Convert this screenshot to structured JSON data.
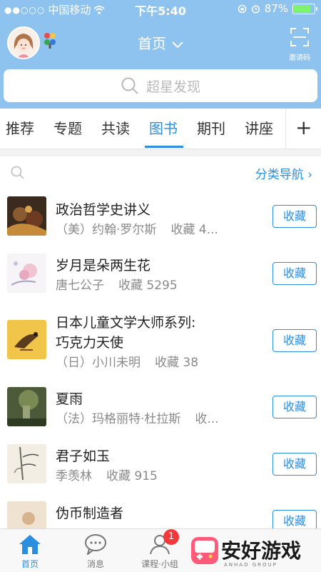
{
  "status_bar": {
    "carrier": "中国移动",
    "time": "下午5:40",
    "battery": "87%",
    "battery_level": 0.87
  },
  "header": {
    "title": "首页",
    "invite_label": "邀请码",
    "search_placeholder": "超星发现"
  },
  "tabs": [
    {
      "label": "推荐"
    },
    {
      "label": "专题"
    },
    {
      "label": "共读"
    },
    {
      "label": "图书"
    },
    {
      "label": "期刊"
    },
    {
      "label": "讲座"
    }
  ],
  "filter": {
    "nav_label": "分类导航 ›"
  },
  "books": [
    {
      "title": "政治哲学史讲义",
      "author": "（美）约翰·罗尔斯",
      "favorites": "收藏 4...",
      "button": "收藏"
    },
    {
      "title": "岁月是朵两生花",
      "author": "唐七公子",
      "favorites": "收藏 5295",
      "button": "收藏"
    },
    {
      "title_line1": "日本儿童文学大师系列:",
      "title_line2": "巧克力天使",
      "author": "（日）小川未明",
      "favorites": "收藏 38",
      "button": "收藏"
    },
    {
      "title": "夏雨",
      "author": "（法）玛格丽特·杜拉斯",
      "favorites": "收...",
      "button": "收藏"
    },
    {
      "title": "君子如玉",
      "author": "季羡林",
      "favorites": "收藏 915",
      "button": "收藏"
    },
    {
      "title": "伪币制造者",
      "button": "收藏"
    }
  ],
  "tabbar": {
    "home": "首页",
    "messages": "消息",
    "courses": "课程·小组",
    "badge": "1"
  },
  "watermark": {
    "text": "安好游戏",
    "sub": "ANHAO GROUP"
  }
}
